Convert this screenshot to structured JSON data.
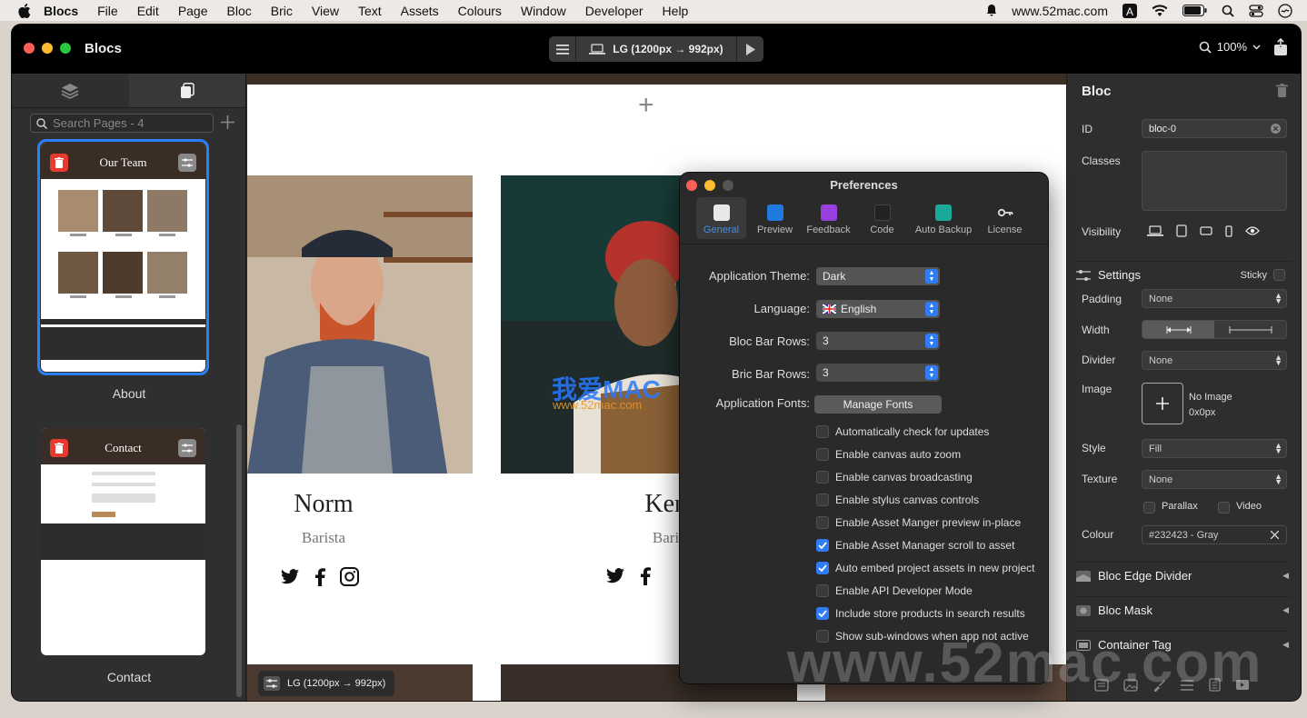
{
  "menubar": {
    "app": "Blocs",
    "items": [
      "File",
      "Edit",
      "Page",
      "Bloc",
      "Bric",
      "View",
      "Text",
      "Assets",
      "Colours",
      "Window",
      "Developer",
      "Help"
    ],
    "site": "www.52mac.com"
  },
  "window": {
    "title": "Blocs",
    "device_label": "LG (1200px → 992px)",
    "zoom": "100%"
  },
  "left_sidebar": {
    "search_placeholder": "Search Pages - 4",
    "pages": [
      {
        "label": "About",
        "header_title": "Our Team",
        "selected": true
      },
      {
        "label": "Contact",
        "header_title": "Contact",
        "selected": false
      }
    ]
  },
  "canvas": {
    "breakpoint_pill": "LG (1200px → 992px)",
    "team": [
      {
        "name": "Norm",
        "role": "Barista"
      },
      {
        "name": "Kerry",
        "role": "Barista"
      }
    ]
  },
  "inspector": {
    "title": "Bloc",
    "id_label": "ID",
    "id_value": "bloc-0",
    "classes_label": "Classes",
    "visibility_label": "Visibility",
    "settings_label": "Settings",
    "sticky_label": "Sticky",
    "padding_label": "Padding",
    "padding_value": "None",
    "width_label": "Width",
    "divider_label": "Divider",
    "divider_value": "None",
    "image_label": "Image",
    "image_name": "No Image",
    "image_size": "0x0px",
    "style_label": "Style",
    "style_value": "Fill",
    "texture_label": "Texture",
    "texture_value": "None",
    "parallax_label": "Parallax",
    "video_label": "Video",
    "colour_label": "Colour",
    "colour_value": "#232423 - Gray",
    "sections": [
      "Bloc Edge Divider",
      "Bloc Mask",
      "Container Tag"
    ]
  },
  "preferences": {
    "title": "Preferences",
    "tabs": [
      {
        "label": "General",
        "active": true,
        "color": "#e8e8e8"
      },
      {
        "label": "Preview",
        "active": false,
        "color": "#1f7ae0"
      },
      {
        "label": "Feedback",
        "active": false,
        "color": "#9b40e0"
      },
      {
        "label": "Code",
        "active": false,
        "color": "#222222"
      },
      {
        "label": "Auto Backup",
        "active": false,
        "color": "#1aa89a"
      },
      {
        "label": "License",
        "active": false,
        "color": "#cccccc"
      }
    ],
    "theme_label": "Application Theme:",
    "theme_value": "Dark",
    "language_label": "Language:",
    "language_value": "English",
    "bloc_rows_label": "Bloc Bar Rows:",
    "bloc_rows_value": "3",
    "bric_rows_label": "Bric Bar Rows:",
    "bric_rows_value": "3",
    "fonts_label": "Application Fonts:",
    "fonts_button": "Manage Fonts",
    "options": [
      {
        "label": "Automatically check for updates",
        "checked": false
      },
      {
        "label": "Enable canvas auto zoom",
        "checked": false
      },
      {
        "label": "Enable canvas broadcasting",
        "checked": false
      },
      {
        "label": "Enable stylus canvas controls",
        "checked": false
      },
      {
        "label": "Enable Asset Manger preview in-place",
        "checked": false
      },
      {
        "label": "Enable Asset Manager scroll to asset",
        "checked": true
      },
      {
        "label": "Auto embed project assets in new project",
        "checked": true
      },
      {
        "label": "Enable API Developer Mode",
        "checked": false
      },
      {
        "label": "Include store products in search results",
        "checked": true
      },
      {
        "label": "Show sub-windows when app not active",
        "checked": false
      }
    ]
  },
  "watermarks": {
    "big": "www.52mac.com",
    "mid": "我爱MAC",
    "sub": "www.52mac.com"
  }
}
